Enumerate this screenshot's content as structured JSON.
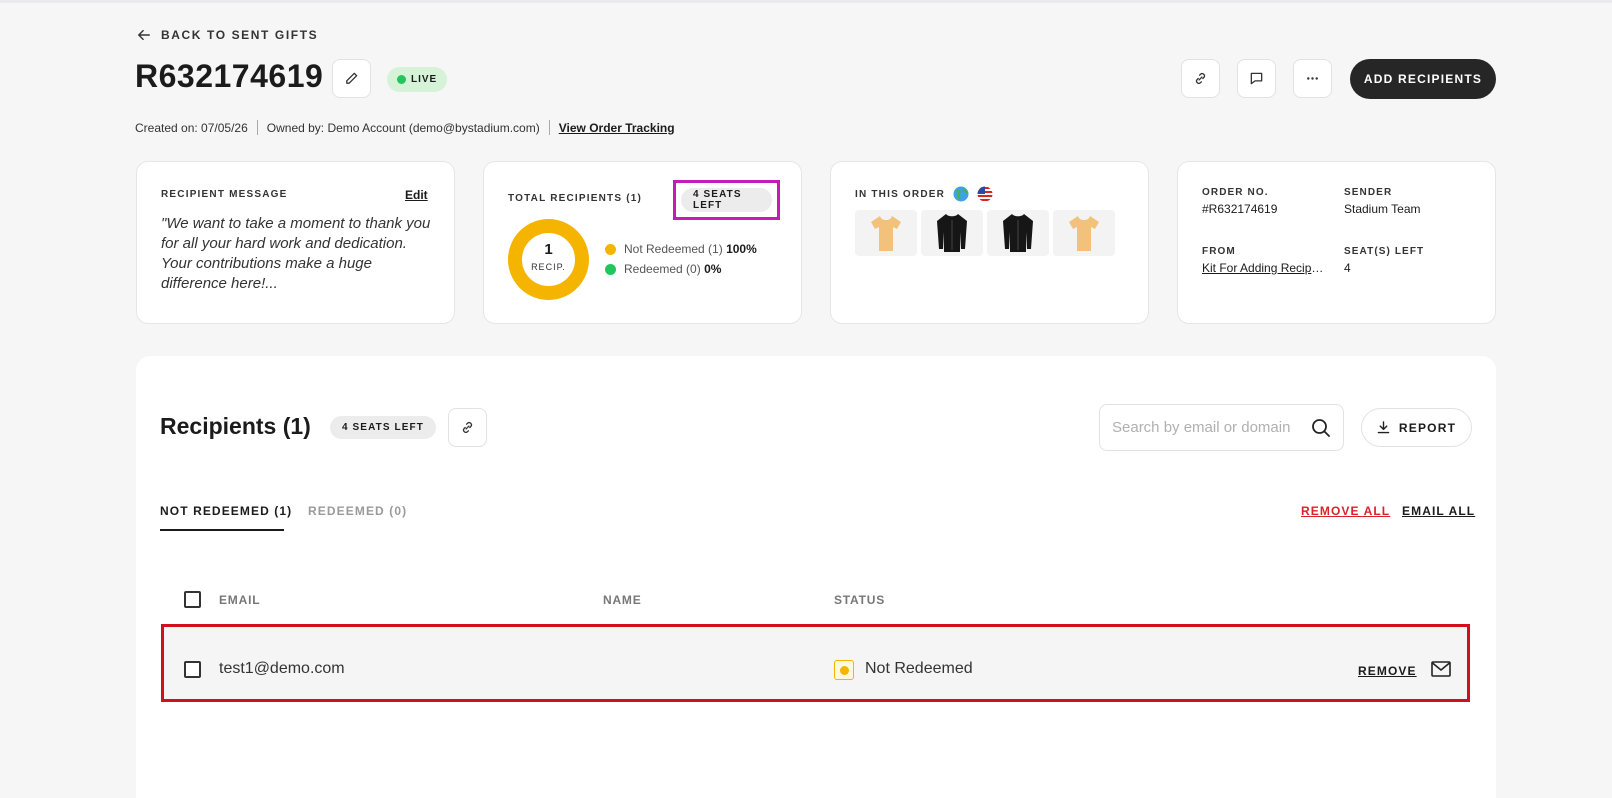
{
  "header": {
    "back_label": "BACK TO SENT GIFTS",
    "order_id": "R632174619",
    "status": "LIVE",
    "created": "Created on: 07/05/26",
    "owner": "Owned by: Demo Account (demo@bystadium.com)",
    "tracking_link": "View Order Tracking",
    "add_button": "ADD RECIPIENTS"
  },
  "message_card": {
    "label": "RECIPIENT MESSAGE",
    "edit": "Edit",
    "text": "\"We want to take a moment to thank you for all your hard work and dedication. Your contributions make a huge difference here!..."
  },
  "recipients_card": {
    "label": "TOTAL RECIPIENTS (1)",
    "seats_left": "4 SEATS LEFT",
    "donut_count": "1",
    "donut_unit": "RECIP.",
    "legend": [
      {
        "label": "Not Redeemed (1)",
        "value": "100%",
        "color": "#f5b400"
      },
      {
        "label": "Redeemed (0)",
        "value": "0%",
        "color": "#22c55e"
      }
    ]
  },
  "order_card": {
    "label": "IN THIS ORDER",
    "products": [
      {
        "name": "yellow-tshirt",
        "color": "#f2c27c"
      },
      {
        "name": "black-hoodie",
        "color": "#161616"
      },
      {
        "name": "black-hoodie",
        "color": "#161616"
      },
      {
        "name": "yellow-tshirt",
        "color": "#f2c27c"
      }
    ]
  },
  "details_card": {
    "order_no_label": "ORDER NO.",
    "order_no": "#R632174619",
    "sender_label": "SENDER",
    "sender": "Stadium Team",
    "from_label": "FROM",
    "from": "Kit For Adding Recipients",
    "seats_label": "SEAT(S) LEFT",
    "seats": "4"
  },
  "recipients_panel": {
    "title": "Recipients (1)",
    "seats_pill": "4 SEATS LEFT",
    "search_placeholder": "Search by email or domain",
    "report": "REPORT",
    "tabs": [
      {
        "label": "NOT REDEEMED (1)",
        "active": true
      },
      {
        "label": "REDEEMED (0)",
        "active": false
      }
    ],
    "remove_all": "REMOVE ALL",
    "email_all": "EMAIL ALL",
    "columns": [
      "EMAIL",
      "NAME",
      "STATUS"
    ],
    "rows": [
      {
        "email": "test1@demo.com",
        "name": "",
        "status": "Not Redeemed",
        "remove": "REMOVE"
      }
    ]
  }
}
